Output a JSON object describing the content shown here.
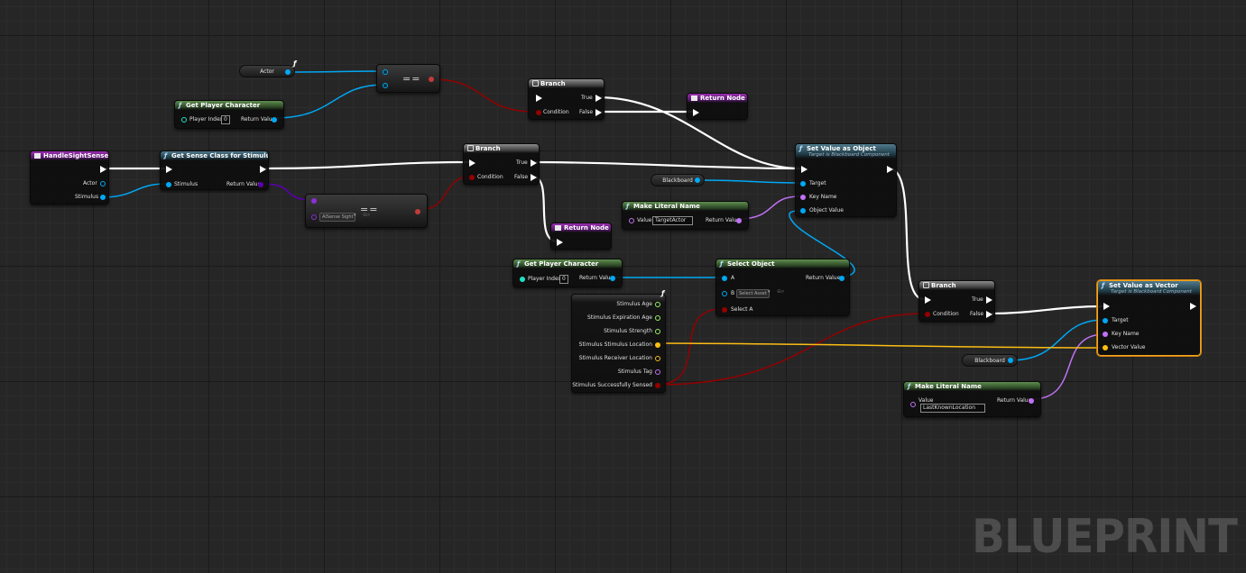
{
  "watermark": "BLUEPRINT",
  "colors": {
    "exec": "#ffffff",
    "object": "#00a8f4",
    "bool": "#940000",
    "class": "#5b00b0",
    "name": "#c172f5",
    "vector": "#fcbd14",
    "float": "#9bf063",
    "selected_outline": "#f3a21b"
  },
  "nodes": {
    "actor_var": {
      "label": "Actor"
    },
    "equal_1": {
      "symbol": "=="
    },
    "get_player_char_1": {
      "title": "Get Player Character",
      "pin_index": "Player Index",
      "index_value": "0",
      "return": "Return Value"
    },
    "branch_1": {
      "title": "Branch",
      "true": "True",
      "false": "False",
      "condition": "Condition"
    },
    "return_node_1": {
      "title": "Return Node"
    },
    "handle_sight": {
      "title": "HandleSightSense",
      "actor": "Actor",
      "stimulus": "Stimulus"
    },
    "get_sense_class": {
      "title": "Get Sense Class for Stimulus",
      "stimulus": "Stimulus",
      "return": "Return Value"
    },
    "equal_2": {
      "symbol": "==",
      "dropdown": "AISense Sight"
    },
    "branch_2": {
      "title": "Branch",
      "true": "True",
      "false": "False",
      "condition": "Condition"
    },
    "return_node_2": {
      "title": "Return Node"
    },
    "set_value_object": {
      "title": "Set Value as Object",
      "subtitle": "Target is Blackboard Component",
      "target": "Target",
      "key_name": "Key Name",
      "object_value": "Object Value"
    },
    "blackboard_1": {
      "label": "Blackboard"
    },
    "make_literal_1": {
      "title": "Make Literal Name",
      "value_label": "Value",
      "value": "TargetActor",
      "return": "Return Value"
    },
    "get_player_char_2": {
      "title": "Get Player Character",
      "pin_index": "Player Index",
      "index_value": "0",
      "return": "Return Value"
    },
    "select_object": {
      "title": "Select Object",
      "a": "A",
      "b": "B",
      "b_dropdown": "Select Asset",
      "select_a": "Select A",
      "return": "Return Value"
    },
    "break_stimulus": {
      "pins": [
        "Stimulus Age",
        "Stimulus Expiration Age",
        "Stimulus Strength",
        "Stimulus Stimulus Location",
        "Stimulus Receiver Location",
        "Stimulus Tag",
        "Stimulus Successfully Sensed"
      ]
    },
    "branch_3": {
      "title": "Branch",
      "true": "True",
      "false": "False",
      "condition": "Condition"
    },
    "set_value_vector": {
      "title": "Set Value as Vector",
      "subtitle": "Target is Blackboard Component",
      "target": "Target",
      "key_name": "Key Name",
      "vector_value": "Vector Value"
    },
    "blackboard_2": {
      "label": "Blackboard"
    },
    "make_literal_2": {
      "title": "Make Literal Name",
      "value_label": "Value",
      "value": "LastKnownLocation",
      "return": "Return Value"
    }
  }
}
